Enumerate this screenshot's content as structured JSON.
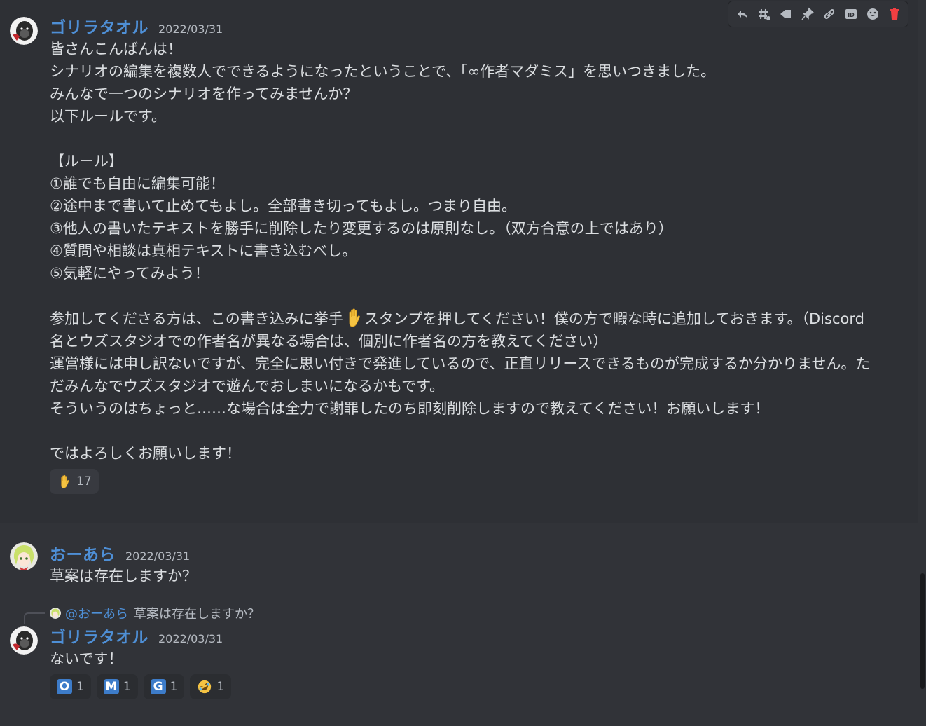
{
  "messages": [
    {
      "author": "ゴリラタオル",
      "timestamp": "2022/03/31",
      "lines": [
        "皆さんこんばんは！",
        "シナリオの編集を複数人でできるようになったということで、「∞作者マダミス」を思いつきました。",
        "みんなで一つのシナリオを作ってみませんか？",
        "以下ルールです。",
        "",
        "【ルール】",
        "①誰でも自由に編集可能！",
        "②途中まで書いて止めてもよし。全部書き切ってもよし。つまり自由。",
        "③他人の書いたテキストを勝手に削除したり変更するのは原則なし。（双方合意の上ではあり）",
        "④質問や相談は真相テキストに書き込むべし。",
        "⑤気軽にやってみよう！",
        ""
      ],
      "para_join_before": "参加してくださる方は、この書き込みに挙手",
      "para_join_after": "スタンプを押してください！僕の方で暇な時に追加しておきます。（Discord名とウズスタジオでの作者名が異なる場合は、個別に作者名の方を教えてください）",
      "para_rest": "\n運営様には申し訳ないですが、完全に思い付きで発進しているので、正直リリースできるものが完成するか分かりません。ただみんなでウズスタジオで遊んでおしまいになるかもです。\nそういうのはちょっと……な場合は全力で謝罪したのち即刻削除しますので教えてください！お願いします！\n\nではよろしくお願いします！",
      "reactions": [
        {
          "emoji": "raised-hand",
          "count": "17"
        }
      ]
    },
    {
      "author": "おーあら",
      "timestamp": "2022/03/31",
      "text": "草案は存在しますか？"
    },
    {
      "reply_to_name": "@おーあら",
      "reply_to_text": "草案は存在しますか？",
      "author": "ゴリラタオル",
      "timestamp": "2022/03/31",
      "text": "ないです！",
      "reactions": [
        {
          "emoji": "letter-o",
          "letter": "O",
          "count": "1"
        },
        {
          "emoji": "letter-m",
          "letter": "M",
          "count": "1"
        },
        {
          "emoji": "letter-g",
          "letter": "G",
          "count": "1"
        },
        {
          "emoji": "rolling-laughing",
          "count": "1"
        }
      ]
    }
  ],
  "toolbar": {
    "icons": [
      "reply-icon",
      "thread-icon",
      "unread-icon",
      "pin-icon",
      "link-icon",
      "id-icon",
      "add-reaction-icon",
      "delete-icon"
    ]
  },
  "colors": {
    "background": "#313338",
    "hover_background": "#2e3035",
    "username": "#4e8fd6",
    "text": "#dbdee1",
    "muted": "#b5bac1",
    "danger": "#f23f42"
  }
}
